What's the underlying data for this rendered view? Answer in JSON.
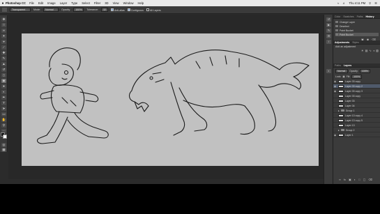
{
  "menubar": {
    "app_name": "Photoshop CC",
    "items": [
      "File",
      "Edit",
      "Image",
      "Layer",
      "Type",
      "Select",
      "Filter",
      "3D",
      "View",
      "Window",
      "Help"
    ],
    "clock": "Thu 4:11 PM"
  },
  "options_bar": {
    "preset": "Transparent",
    "mode_label": "Mode:",
    "mode_value": "Normal",
    "opacity_label": "Opacity:",
    "opacity_value": "100%",
    "tolerance_label": "Tolerance:",
    "tolerance_value": "32",
    "antialias_label": "Anti-alias",
    "contiguous_label": "Contiguous",
    "all_layers_label": "All Layers"
  },
  "history_panel": {
    "tabs": [
      "Color",
      "Swatches",
      "Paths",
      "History"
    ],
    "active_tab": "History",
    "items": [
      "Change Layer",
      "Deselect",
      "Paint Bucket",
      "Paint Bucket"
    ]
  },
  "adjustments_panel": {
    "tabs": [
      "Adjustments",
      "Styles"
    ],
    "title": "Add an adjustment"
  },
  "layers_panel": {
    "tabs": [
      "Paths",
      "Layers"
    ],
    "active_tab": "Layers",
    "blend_mode": "Normal",
    "opacity_label": "Opacity:",
    "opacity_value": "100%",
    "fill_label": "Fill:",
    "fill_value": "100%",
    "lock_label": "Lock:",
    "layers": [
      {
        "name": "Layer 33 copy",
        "visible": true,
        "selected": false,
        "group": false
      },
      {
        "name": "Layer 33 copy 2",
        "visible": true,
        "selected": true,
        "group": false
      },
      {
        "name": "Layer 33 copy 3",
        "visible": true,
        "selected": false,
        "group": false
      },
      {
        "name": "Layer 33 copy",
        "visible": false,
        "selected": false,
        "group": false
      },
      {
        "name": "Layer 33",
        "visible": false,
        "selected": false,
        "group": false
      },
      {
        "name": "Layer 34",
        "visible": false,
        "selected": false,
        "group": false
      },
      {
        "name": "Group 1",
        "visible": false,
        "selected": false,
        "group": true
      },
      {
        "name": "Layer 13 copy 4",
        "visible": false,
        "selected": false,
        "group": false
      },
      {
        "name": "Layer 13 copy 5",
        "visible": false,
        "selected": false,
        "group": false
      },
      {
        "name": "Layer 13",
        "visible": false,
        "selected": false,
        "group": false
      },
      {
        "name": "Group 2",
        "visible": false,
        "selected": false,
        "group": true
      },
      {
        "name": "Layer 1",
        "visible": true,
        "selected": false,
        "group": false
      }
    ]
  },
  "colors": {
    "foreground": "#111111",
    "background": "#ffffff",
    "canvas": "#c1c1c1",
    "selection": "#4f5a6b"
  }
}
